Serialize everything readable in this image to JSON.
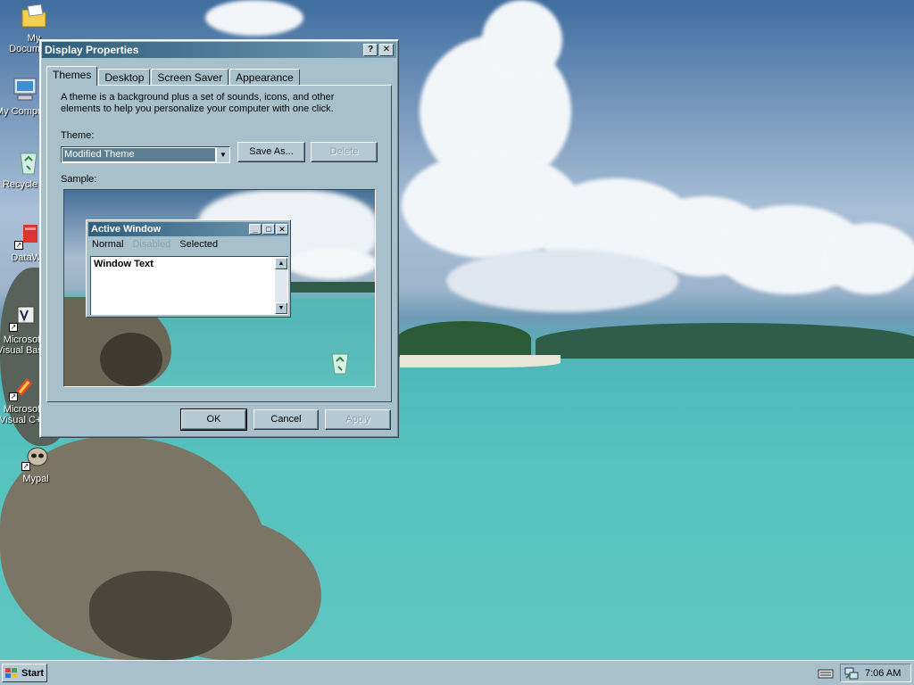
{
  "desktop": {
    "icons": [
      {
        "label": "My Documents"
      },
      {
        "label": "My Computer"
      },
      {
        "label": "Recycle Bin"
      },
      {
        "label": "DataWa"
      },
      {
        "label": "Microsoft Visual Basic"
      },
      {
        "label": "Microsoft Visual C++"
      },
      {
        "label": "Mypal"
      }
    ]
  },
  "dialog": {
    "title": "Display Properties",
    "help_button": "?",
    "close_button": "✕",
    "tabs": [
      {
        "label": "Themes",
        "active": true
      },
      {
        "label": "Desktop",
        "active": false
      },
      {
        "label": "Screen Saver",
        "active": false
      },
      {
        "label": "Appearance",
        "active": false
      }
    ],
    "description": "A theme is a background plus a set of sounds, icons, and other elements to help you personalize your computer with one click.",
    "theme_label": "Theme:",
    "theme_value": "Modified Theme",
    "save_as_label": "Save As...",
    "delete_label": "Delete",
    "sample_label": "Sample:",
    "sample": {
      "window_title": "Active Window",
      "menu_normal": "Normal",
      "menu_disabled": "Disabled",
      "menu_selected": "Selected",
      "window_text": "Window Text"
    },
    "ok_label": "OK",
    "cancel_label": "Cancel",
    "apply_label": "Apply"
  },
  "taskbar": {
    "start_label": "Start",
    "clock": "7:06 AM"
  },
  "colors": {
    "window_face": "#a8c0cc",
    "title_start": "#2e5e7c",
    "title_end": "#6f98b3",
    "selection": "#5d7f93"
  }
}
